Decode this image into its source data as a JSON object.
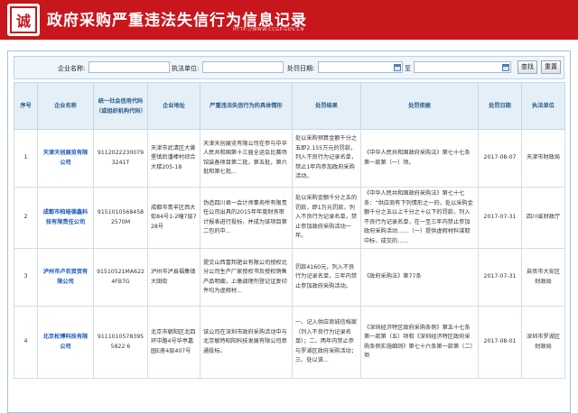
{
  "header": {
    "logo_char": "诚",
    "title": "政府采购严重违法失信行为信息记录",
    "url": "HTTP://WWW.CCGP.GOV.CN"
  },
  "search": {
    "company_label": "企业名称:",
    "company_value": "",
    "unit_label": "执法单位:",
    "unit_value": "",
    "date_label": "处罚日期:",
    "date_from": "",
    "date_sep": "至",
    "date_to": "",
    "search_button": "查找",
    "reset_button": "重置"
  },
  "table": {
    "headers": {
      "index": "序号",
      "company": "企业名称",
      "credit_code": "统一社会信用代码（或组织机构代码）",
      "address": "企业地址",
      "violation": "严重违法失信行为的具体情形",
      "result": "处罚结果",
      "basis": "处罚依据",
      "date": "处罚日期",
      "unit": "执法单位"
    },
    "rows": [
      {
        "index": "1",
        "company": "天津天创展览有限公司",
        "credit_code": "91120222300793241T",
        "address": "天津市武清区大黄堡镇后潘棒村综合大楼205-18",
        "violation": "天津天创展览有限公司在参与中华人民共和国第十三届全运会比赛场馆装备项目第二批，第五批，第六批和第七批...",
        "result": "处以采购预算金额千分之五即2.155万元的罚款，列入不良行为记录名单，禁止1年内参加政府采购活动。",
        "basis": "《中华人民共和国政府采购法》第七十七条第一款第（一）项。",
        "date": "2017-08-07",
        "unit": "天津市财政局"
      },
      {
        "index": "2",
        "company": "成都市柏珞德鑫科技有限责任公司",
        "credit_code": "91510105684582570M",
        "address": "成都市青羊区西大街84号1-2幢7层728号",
        "violation": "伪造四川君一会计师事务所有限责任公司出具的2015年年度财务审计报表进行投标，并成为该项目第二包的中...",
        "result": "处以采购金额千分之五的罚款，即1万元罚款，列入不良行为记录名单，禁止参加政府采购活动一年。",
        "basis": "《中华人民共和国政府采购法》第七十七条：“供应商有下列情形之一的，处以采购金额千分之五以上千分之十以下的罚款，列入不良行为记录名单，在一至三年内禁止参加政府采购活动……（一）提供虚假材料谋取中标、成交的……",
        "date": "2017-07-31",
        "unit": "四川省财政厅"
      },
      {
        "index": "3",
        "company": "泸州市卢农资贸有限公司",
        "credit_code": "91510521MA6224FB7G",
        "address": "泸州市泸县福集镇大田街",
        "violation": "提交山西富邦肥业有限公司授权北分公司生产厂家授权书及授权销售产品明细，上缴调理剂登记证复印件均为虚假材...",
        "result": "罚款4160元，列入不良行为记录名单，三年内禁止参加政府采购活动。",
        "basis": "《政府采购法》第77条",
        "date": "2017-07-31",
        "unit": "自贡市大安区财政局"
      },
      {
        "index": "4",
        "company": "北京松博科技有限公司",
        "credit_code": "91110105783955822 6",
        "address": "北京市朝阳区北四环中路4号华亭嘉园E座4层407号",
        "violation": "该公司在深圳市政府采购活动中与北京敏特昭阳科技发展有限公司串通投标。",
        "result": "一、记入供应商诚信档案（列入不良行为记录名单）；二、两年内禁止参与罗湖区政府采购活动；三、处以该...",
        "basis": "《深圳经济特区政府采购条例》第五十七条第一款第（五）项和《深圳经济特区政府采购条例实施细则》第七十六条第一款第（二）项",
        "date": "2017-08-01",
        "unit": "深圳市罗湖区财政局"
      }
    ]
  },
  "colors": {
    "brand_red": "#c8161d",
    "header_blue": "#2a5c88",
    "link_blue": "#1a56b8"
  }
}
